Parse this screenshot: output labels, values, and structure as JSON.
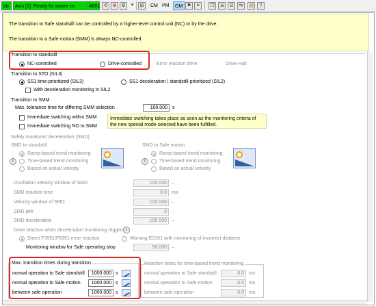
{
  "toolbar": {
    "status_bb": "bb",
    "axis_status": "Axis [1]:  Ready for power on",
    "code": "A001",
    "modes": [
      "CM",
      "PM",
      "OM"
    ],
    "active_mode": "OM"
  },
  "info": {
    "line1": "The transition to Safe standstill can be controlled by a higher-level control unit (NC) or by the drive.",
    "line2": "The transition to a Safe motion (SMM) is always NC-controlled."
  },
  "standstill": {
    "title": "Transition to standstill",
    "opt_nc": "NC-controlled",
    "opt_drive": "Drive-controlled",
    "error_reaction_label": "Error reaction drive",
    "error_reaction_value": "Drive Halt"
  },
  "sto": {
    "title": "Transition to STO (SIL3)",
    "opt_sil3": "SS1 time-prioritized (SIL3)",
    "opt_sil2": "SS1 deceleration / standstill-prioritized (SIL2)",
    "check_decel": "With deceleration monitoring in SIL2"
  },
  "smm": {
    "title": "Transition to SMM",
    "max_tol_label": "Max. tolerance time for differing SMM selection",
    "max_tol_value": "100.000",
    "max_tol_unit": "s",
    "check_within": "Immediate switching within SMM",
    "check_no": "Immediate switching NO to SMM",
    "note": "Immediate switching takes place as soon as the monitoring criteria of the new special mode selected have been fulfilled."
  },
  "smd": {
    "title": "Safely monitored deceleration (SMD)",
    "left_title": "SMD to standstill",
    "right_title": "SMD to Safe motion",
    "opt_ramp": "Ramp-based trend monitoring",
    "opt_time": "Time-based trend monitoring",
    "opt_velocity": "Based on actual velocity",
    "fields": [
      {
        "label": "Oscillation velocity window of SMD",
        "value": "100 000",
        "unit": "–"
      },
      {
        "label": "SMD reaction time",
        "value": "0.0",
        "unit": "ms"
      },
      {
        "label": "Velocity window of SMD",
        "value": "100 000",
        "unit": "–"
      },
      {
        "label": "SMD jerk",
        "value": "0",
        "unit": "–"
      },
      {
        "label": "SMD deceleration",
        "value": "100 000",
        "unit": "–"
      }
    ],
    "drive_reaction_title": "Drive reaction when deceleration monitoring triggers",
    "opt_direct": "Direct F7051/F8351 error reaction",
    "opt_warning": "Warning E3151 with monitoring of incorrect distance",
    "monitor_label": "Monitoring window for Safe operating stop",
    "monitor_value": "50 000",
    "monitor_unit": "–"
  },
  "max_times": {
    "title": "Max. transition times during transition ...",
    "rows": [
      {
        "label": "normal operation to Safe standstill",
        "value": "1000.000",
        "unit": "s"
      },
      {
        "label": "normal operation to Safe motion",
        "value": "1000.000",
        "unit": "s"
      },
      {
        "label": "between safe operation",
        "value": "1000.000",
        "unit": "s"
      }
    ]
  },
  "reaction_times": {
    "title": "Reaction times for time-based trend monitoring",
    "rows": [
      {
        "label": "normal operation to Safe standstill",
        "value": "0.0",
        "unit": "ms"
      },
      {
        "label": "normal operation to Safe motion",
        "value": "0.0",
        "unit": "ms"
      },
      {
        "label": "between safe operation",
        "value": "0.0",
        "unit": "ms"
      }
    ]
  }
}
